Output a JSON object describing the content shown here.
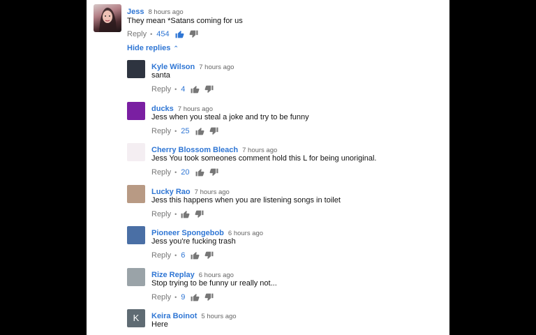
{
  "top_comment": {
    "author": "Jess",
    "time": "8 hours ago",
    "text": "They mean *Satans coming for us",
    "reply_label": "Reply",
    "likes": "454",
    "liked": true
  },
  "hide_replies_label": "Hide replies",
  "replies": [
    {
      "author": "Kyle Wilson",
      "time": "7 hours ago",
      "text": "santa",
      "likes": "4",
      "avatar_color": "#2e3440"
    },
    {
      "author": "ducks",
      "time": "7 hours ago",
      "text": "Jess when you steal a joke and try to be funny",
      "likes": "25",
      "avatar_color": "#7a1fa2"
    },
    {
      "author": "Cherry Blossom Bleach",
      "time": "7 hours ago",
      "text": "Jess You took someones comment hold this L for being unoriginal.",
      "likes": "20",
      "avatar_color": "#f4eef2"
    },
    {
      "author": "Lucky Rao",
      "time": "7 hours ago",
      "text": "Jess this happens when you are listening songs in toilet",
      "likes": "",
      "avatar_color": "#b89a84"
    },
    {
      "author": "Pioneer Spongebob",
      "time": "6 hours ago",
      "text": "Jess you're fucking trash",
      "likes": "6",
      "avatar_color": "#4a6fa5"
    },
    {
      "author": "Rize Replay",
      "time": "6 hours ago",
      "text": "Stop trying to be funny ur really not...",
      "likes": "9",
      "avatar_color": "#9aa3a8"
    },
    {
      "author": "Keira Boinot",
      "time": "5 hours ago",
      "text": "Here",
      "likes": "",
      "avatar_color": "#5f6b73",
      "avatar_letter": "K"
    }
  ],
  "reply_label": "Reply",
  "colors": {
    "link": "#2f76d4",
    "background": "#ffffff",
    "letterbox": "#000000"
  }
}
